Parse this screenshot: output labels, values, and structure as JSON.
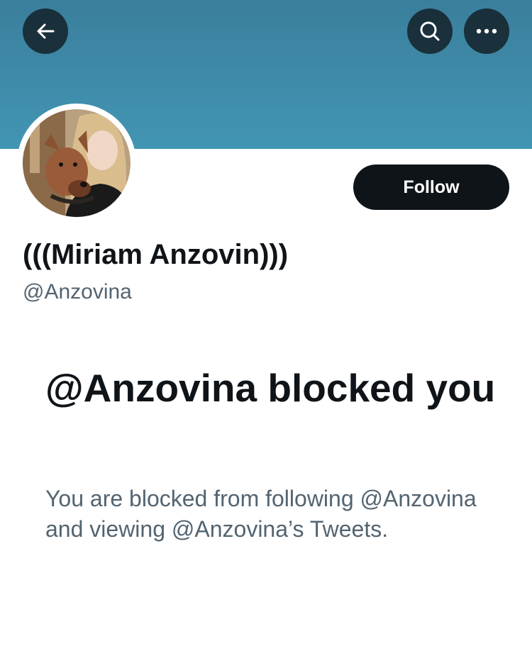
{
  "header": {
    "back_icon": "arrow-left-icon",
    "search_icon": "search-icon",
    "more_icon": "more-horizontal-icon",
    "banner_color": "#3f8fae"
  },
  "profile": {
    "display_name": "(((Miriam Anzovin)))",
    "handle": "@Anzovina",
    "follow_label": "Follow"
  },
  "blocked": {
    "title": "@Anzovina blocked you",
    "description": "You are blocked from following @Anzovina and viewing @Anzovina’s Tweets."
  }
}
